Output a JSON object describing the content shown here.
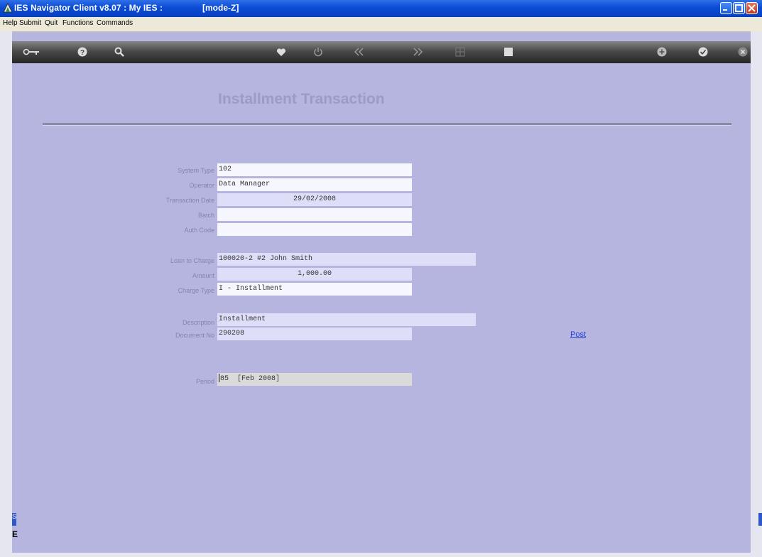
{
  "window": {
    "title": "IES Navigator Client v8.07 : My IES :",
    "mode": "[mode-Z]"
  },
  "menu": [
    "Help",
    "Submit",
    "Quit",
    "Functions",
    "Commands"
  ],
  "toolbar": {
    "icons": [
      "key-icon",
      "help-icon",
      "search-icon",
      "heart-icon",
      "power-icon",
      "previous-icon",
      "next-icon",
      "grid-icon",
      "stop-icon",
      "add-icon",
      "check-icon",
      "close-icon"
    ]
  },
  "page": {
    "title": "Installment Transaction",
    "post_link": "Post"
  },
  "fields": {
    "system_type": {
      "label": "System Type",
      "value": "102"
    },
    "operator": {
      "label": "Operator",
      "value": "Data Manager"
    },
    "transaction_date": {
      "label": "Transaction Date",
      "value": "29/02/2008"
    },
    "batch": {
      "label": "Batch",
      "value": ""
    },
    "auth_code": {
      "label": "Auth Code",
      "value": ""
    },
    "loan_to_charge": {
      "label": "Loan to Charge",
      "value": "100020-2 #2 John Smith"
    },
    "amount": {
      "label": "Amount",
      "value": "1,000.00"
    },
    "charge_type": {
      "label": "Charge Type",
      "value": "I - Installment"
    },
    "description": {
      "label": "Description",
      "value": "Installment"
    },
    "document_no": {
      "label": "Document No",
      "value": "290208"
    },
    "period": {
      "label": "Period",
      "value": "85  [Feb 2008]"
    }
  },
  "sidebar": {
    "tab_label": "Se",
    "bottom_char": "E"
  },
  "colors": {
    "background": "#b5b5e0",
    "title_bar": "#0a4bd4",
    "link": "#1e3cd2",
    "label": "#8484ac"
  }
}
